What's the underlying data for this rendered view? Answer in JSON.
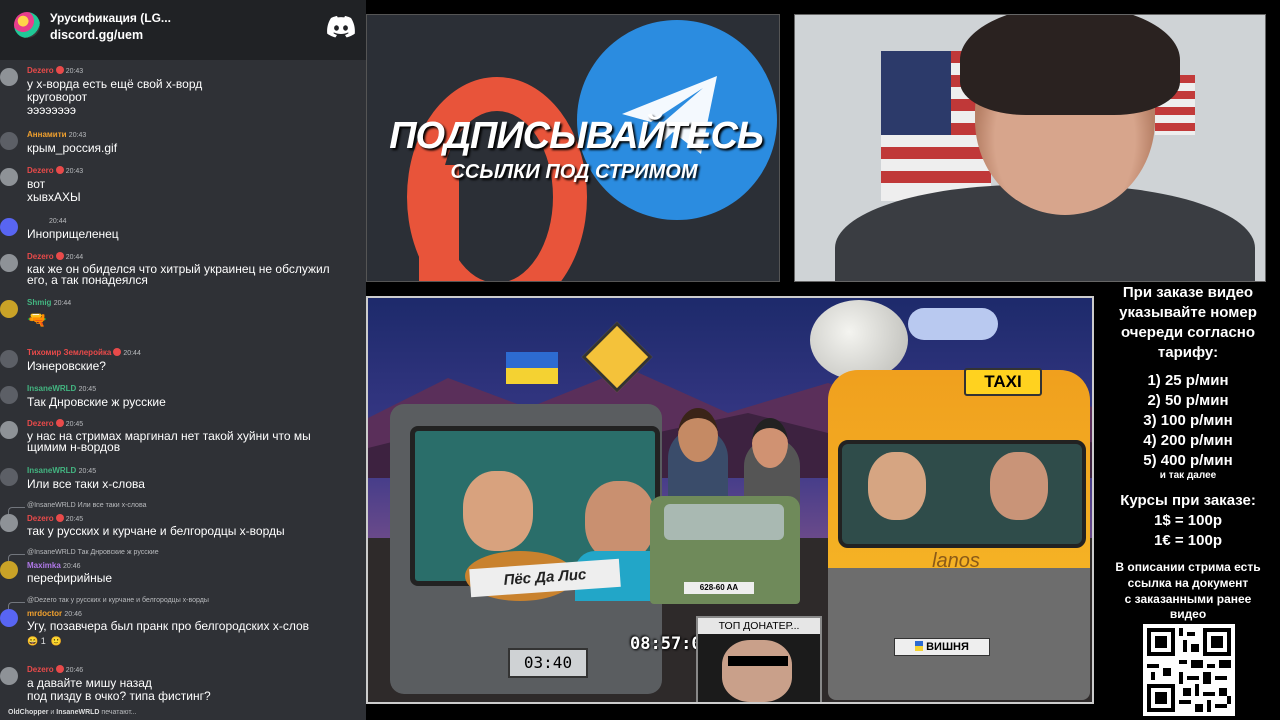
{
  "chat": {
    "server_name": "Урусификация (LG...",
    "invite_link": "discord.gg/uem",
    "typing": {
      "user1": "OldChopper",
      "conj": "и",
      "user2": "InsaneWRLD",
      "suffix": "печатают..."
    },
    "messages": [
      {
        "author": "Dezero",
        "time": "20:43",
        "lines": [
          "у х-ворда есть ещё свой х-ворд",
          "круговорот",
          "ээээээээ"
        ]
      },
      {
        "author": "Аннамити",
        "time": "20:43",
        "lines": [
          "крым_россия.gif"
        ]
      },
      {
        "author": "Dezero",
        "time": "20:43",
        "lines": [
          "вот",
          "хывхАХЫ"
        ]
      },
      {
        "author": "",
        "time": "20:44",
        "lines": [
          "Иноприщеленец"
        ]
      },
      {
        "author": "Dezero",
        "time": "20:44",
        "lines": [
          "как же он обиделся что хитрый украинец не обслужил",
          "его, а так понадеялся"
        ]
      },
      {
        "author": "Shmig",
        "time": "20:44",
        "lines": [
          "🔫"
        ]
      },
      {
        "author": "Тихомир Землеройка",
        "time": "20:44",
        "lines": [
          "Иэнеровские?"
        ]
      },
      {
        "author": "InsaneWRLD",
        "time": "20:45",
        "lines": [
          "Так Днровские ж русские"
        ]
      },
      {
        "author": "Dezero",
        "time": "20:45",
        "lines": [
          "у нас на стримах маргинал нет такой хуйни что мы",
          "щимим н-вордов"
        ]
      },
      {
        "author": "InsaneWRLD",
        "time": "20:45",
        "lines": [
          "Или все таки х-слова"
        ]
      },
      {
        "author": "Dezero",
        "time": "20:45",
        "reply": "@InsaneWRLD Или все таки х-слова",
        "lines": [
          "так у русских и курчане и белгородцы х-ворды"
        ]
      },
      {
        "author": "Maximka",
        "time": "20:46",
        "reply": "@InsaneWRLD Так Днровские ж русские",
        "lines": [
          "перефирийные"
        ]
      },
      {
        "author": "mrdoctor",
        "time": "20:46",
        "reply": "@Dezero так у русских и курчане и белгородцы х-ворды",
        "lines": [
          "Угу, позавчера был пранк про белгородских х-слов"
        ]
      },
      {
        "author": "Dezero",
        "time": "20:46",
        "lines": [
          "а давайте мишу назад",
          "под пизду в очко? типа фистинг?"
        ]
      }
    ]
  },
  "promo": {
    "title": "ПОДПИСЫВАЙТЕСЬ",
    "subtitle": "ССЫЛКИ ПОД СТРИМОМ"
  },
  "scene": {
    "truck_label": "Пёс Да Лис",
    "truck_timer": "03:40",
    "stream_clock": "08:57:07",
    "top_donor": "ТОП ДОНАТЕР...",
    "taxi_sign": "TAXI",
    "van_logo": "lanos",
    "van_plate": "ВИШНЯ",
    "niva_plate": "628-60 AA"
  },
  "info": {
    "heading": [
      "При заказе видео",
      "указывайте номер",
      "очереди согласно",
      "тарифу:"
    ],
    "tariffs": [
      "1) 25 р/мин",
      "2) 50 р/мин",
      "3) 100 р/мин",
      "4) 200 р/мин",
      "5) 400 р/мин"
    ],
    "etc": "и так далее",
    "rates_heading": "Курсы при заказе:",
    "rates": [
      "1$ = 100р",
      "1€ = 100р"
    ],
    "description": [
      "В описании стрима есть",
      "ссылка на документ",
      "с заказанными ранее",
      "видео"
    ]
  },
  "colors": {
    "discord_bg": "#2f3136",
    "discord_header": "#202225",
    "author_red": "#e84a4a",
    "author_green": "#43b581",
    "taxi_yellow": "#ffd21f",
    "van_orange": "#f0a01e"
  }
}
